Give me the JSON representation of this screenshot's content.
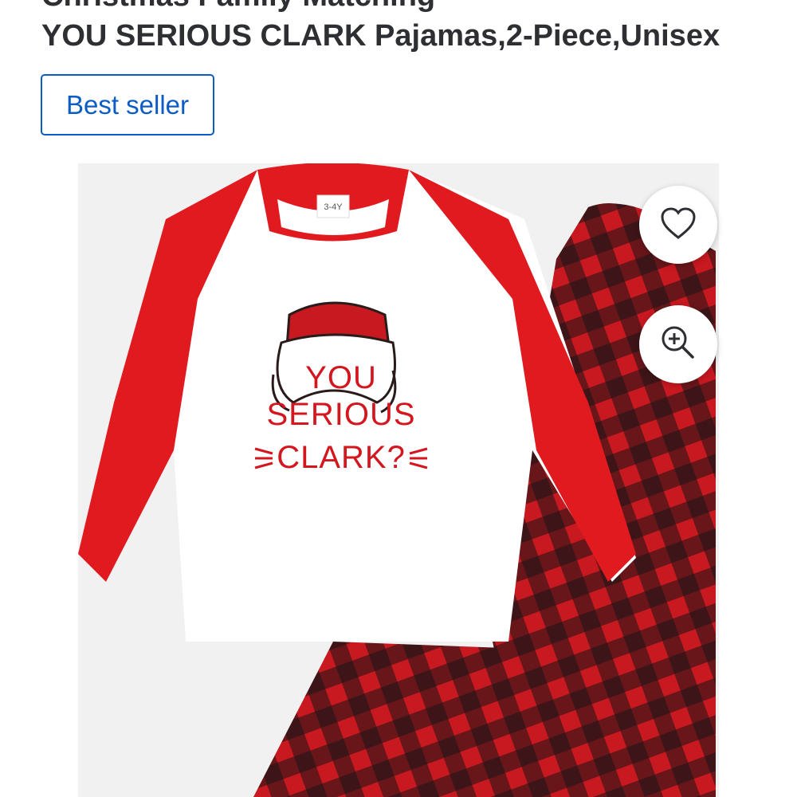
{
  "product": {
    "title_line_1": "Christmas Family Matching",
    "title_line_2": "YOU SERIOUS CLARK Pajamas,2-Piece,Unisex",
    "badge": "Best seller"
  },
  "image": {
    "shirt_print_line_1": "YOU",
    "shirt_print_line_2": "SERIOUS",
    "shirt_print_line_3": "CLARK?",
    "size_label": "3-4Y"
  },
  "actions": {
    "favorite_icon": "heart-icon",
    "zoom_icon": "zoom-in-icon"
  },
  "colors": {
    "brand_blue": "#0b5cc4",
    "pajama_red": "#d4161f",
    "plaid_black": "#1a1416"
  }
}
